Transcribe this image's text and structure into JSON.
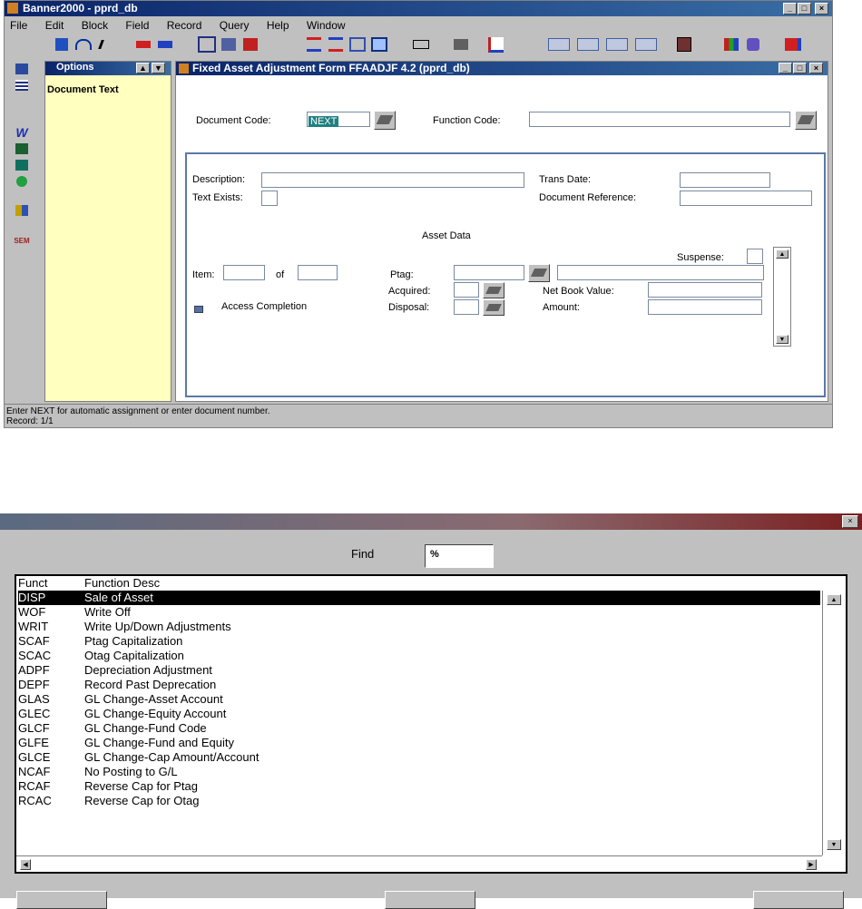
{
  "app_title": "Banner2000 - pprd_db",
  "menu": [
    "File",
    "Edit",
    "Block",
    "Field",
    "Record",
    "Query",
    "Help",
    "Window"
  ],
  "options_panel": {
    "title": "Options",
    "items": [
      "Document Text"
    ]
  },
  "form": {
    "title": "Fixed Asset Adjustment Form  FFAADJF 4.2  (pprd_db)",
    "document_code_label": "Document Code:",
    "document_code_value": "NEXT",
    "function_code_label": "Function Code:",
    "description_label": "Description:",
    "text_exists_label": "Text Exists:",
    "trans_date_label": "Trans Date:",
    "document_reference_label": "Document Reference:",
    "asset_data_heading": "Asset Data",
    "suspense_label": "Suspense:",
    "item_label": "Item:",
    "of_label": "of",
    "ptag_label": "Ptag:",
    "acquired_label": "Acquired:",
    "disposal_label": "Disposal:",
    "net_book_value_label": "Net Book Value:",
    "amount_label": "Amount:",
    "access_completion_label": "Access Completion"
  },
  "status_bar": {
    "message": "Enter NEXT for automatic assignment or enter document number.",
    "record": "Record: 1/1"
  },
  "lov": {
    "find_label": "Find",
    "find_value": "%",
    "columns": [
      "Funct",
      "Function  Desc"
    ],
    "rows": [
      {
        "code": "DISP",
        "desc": "Sale of Asset",
        "selected": true
      },
      {
        "code": "WOF",
        "desc": "Write Off"
      },
      {
        "code": "WRIT",
        "desc": "Write Up/Down Adjustments"
      },
      {
        "code": "SCAF",
        "desc": "Ptag Capitalization"
      },
      {
        "code": "SCAC",
        "desc": "Otag Capitalization"
      },
      {
        "code": "ADPF",
        "desc": "Depreciation Adjustment"
      },
      {
        "code": "DEPF",
        "desc": "Record Past Deprecation"
      },
      {
        "code": "GLAS",
        "desc": "GL Change-Asset Account"
      },
      {
        "code": "GLEC",
        "desc": "GL Change-Equity Account"
      },
      {
        "code": "GLCF",
        "desc": "GL Change-Fund Code"
      },
      {
        "code": "GLFE",
        "desc": "GL Change-Fund and Equity"
      },
      {
        "code": "GLCE",
        "desc": "GL Change-Cap Amount/Account"
      },
      {
        "code": "NCAF",
        "desc": "No Posting to G/L"
      },
      {
        "code": "RCAF",
        "desc": "Reverse Cap for Ptag"
      },
      {
        "code": "RCAC",
        "desc": "Reverse Cap for Otag"
      }
    ]
  }
}
